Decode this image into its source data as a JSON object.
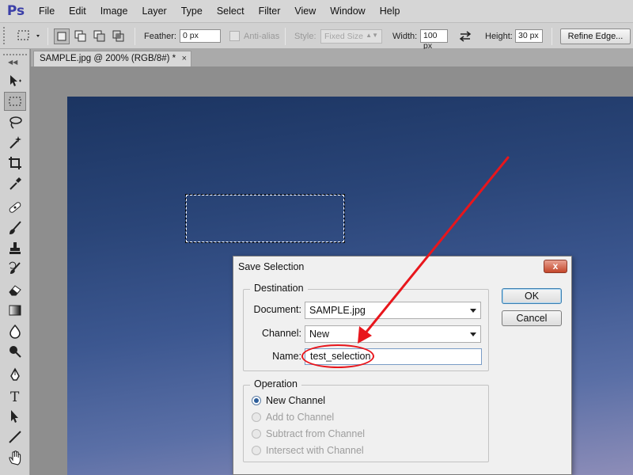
{
  "app": {
    "logo": "Ps",
    "menu": [
      "File",
      "Edit",
      "Image",
      "Layer",
      "Type",
      "Select",
      "Filter",
      "View",
      "Window",
      "Help"
    ]
  },
  "options_bar": {
    "feather_label": "Feather:",
    "feather_value": "0 px",
    "antialias_label": "Anti-alias",
    "style_label": "Style:",
    "style_value": "Fixed Size",
    "width_label": "Width:",
    "width_value": "100 px",
    "height_label": "Height:",
    "height_value": "30 px",
    "refine_edge_label": "Refine Edge..."
  },
  "document_tab": {
    "title": "SAMPLE.jpg @ 200% (RGB/8#) *",
    "close": "×"
  },
  "toolbox": {
    "tools": [
      "move-tool",
      "rectangular-marquee-tool",
      "lasso-tool",
      "magic-wand-tool",
      "crop-tool",
      "eyedropper-tool",
      "healing-brush-tool",
      "brush-tool",
      "clone-stamp-tool",
      "history-brush-tool",
      "eraser-tool",
      "gradient-tool",
      "blur-tool",
      "dodge-tool",
      "pen-tool",
      "type-tool",
      "path-selection-tool",
      "line-tool",
      "hand-tool"
    ],
    "active": "rectangular-marquee-tool"
  },
  "dialog": {
    "title": "Save Selection",
    "close": "x",
    "destination": {
      "legend": "Destination",
      "document_label": "Document:",
      "document_value": "SAMPLE.jpg",
      "channel_label": "Channel:",
      "channel_value": "New",
      "name_label": "Name:",
      "name_value": "test_selection"
    },
    "operation": {
      "legend": "Operation",
      "options": [
        {
          "label": "New Channel",
          "checked": true,
          "enabled": true
        },
        {
          "label": "Add to Channel",
          "checked": false,
          "enabled": false
        },
        {
          "label": "Subtract from Channel",
          "checked": false,
          "enabled": false
        },
        {
          "label": "Intersect with Channel",
          "checked": false,
          "enabled": false
        }
      ]
    },
    "ok_label": "OK",
    "cancel_label": "Cancel"
  },
  "colors": {
    "annotation": "#e8161c",
    "ps_logo": "#3b3fa8"
  }
}
